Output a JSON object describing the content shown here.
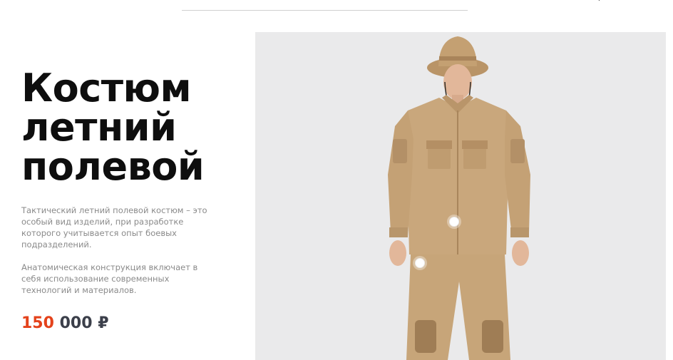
{
  "header": {
    "divider": true,
    "corner_mark": "‹"
  },
  "product": {
    "title_line_1": "Костюм",
    "title_line_2": "летний",
    "title_line_3": "полевой",
    "description_1": "Тактический летний полевой костюм – это особый вид изделий, при разработке которого учитывается опыт боевых подразделений.",
    "description_2": "Анатомическая конструкция включает в себя использование современных технологий и материалов.",
    "price_highlight": "150",
    "price_rest": "000",
    "currency": "₽",
    "image_alt": "Мужчина в летнем полевом костюме песочного цвета и панаме",
    "hotspot_count": 2
  },
  "colors": {
    "accent": "#e4421b",
    "price_text": "#3b3f4a",
    "title_text": "#0e0e0e",
    "body_text": "#8a8a8a",
    "photo_background": "#eaeaeb",
    "suit_khaki": "#c9a77c"
  }
}
